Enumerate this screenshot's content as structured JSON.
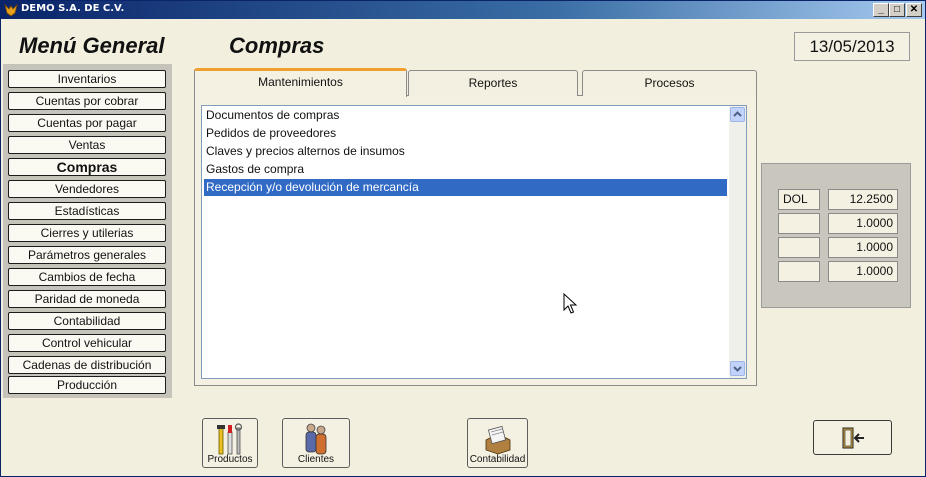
{
  "window": {
    "title": "DEMO  S.A. DE C.V.",
    "minimize": "_",
    "maximize": "□",
    "close": "✕"
  },
  "header": {
    "menu_title": "Menú General",
    "section_title": "Compras",
    "date": "13/05/2013"
  },
  "sidebar": {
    "items": [
      {
        "label": "Inventarios"
      },
      {
        "label": "Cuentas por cobrar"
      },
      {
        "label": "Cuentas por pagar"
      },
      {
        "label": "Ventas"
      },
      {
        "label": "Compras",
        "active": true
      },
      {
        "label": "Vendedores"
      },
      {
        "label": "Estadísticas"
      },
      {
        "label": "Cierres y utilerias"
      },
      {
        "label": "Parámetros generales"
      },
      {
        "label": "Cambios de fecha"
      },
      {
        "label": "Paridad de moneda"
      },
      {
        "label": "Contabilidad"
      },
      {
        "label": "Control vehicular"
      },
      {
        "label": "Cadenas de distribución"
      },
      {
        "label": "Producción"
      }
    ]
  },
  "tabs": [
    {
      "label": "Mantenimientos",
      "active": true
    },
    {
      "label": "Reportes"
    },
    {
      "label": "Procesos"
    }
  ],
  "list": {
    "items": [
      {
        "label": "Documentos de compras"
      },
      {
        "label": "Pedidos de proveedores"
      },
      {
        "label": "Claves y precios alternos de insumos"
      },
      {
        "label": "Gastos de compra"
      },
      {
        "label": "Recepción y/o devolución de mercancía",
        "selected": true
      }
    ]
  },
  "rates": [
    {
      "label": "DOL",
      "value": "12.2500"
    },
    {
      "label": "",
      "value": "1.0000"
    },
    {
      "label": "",
      "value": "1.0000"
    },
    {
      "label": "",
      "value": "1.0000"
    }
  ],
  "toolbar": {
    "productos_label": "Productos",
    "clientes_label": "Clientes",
    "contabilidad_label": "Contabilidad"
  },
  "colors": {
    "accent": "#316ac5",
    "titlebar": "#0a246a",
    "tab_highlight": "#f0a030"
  }
}
